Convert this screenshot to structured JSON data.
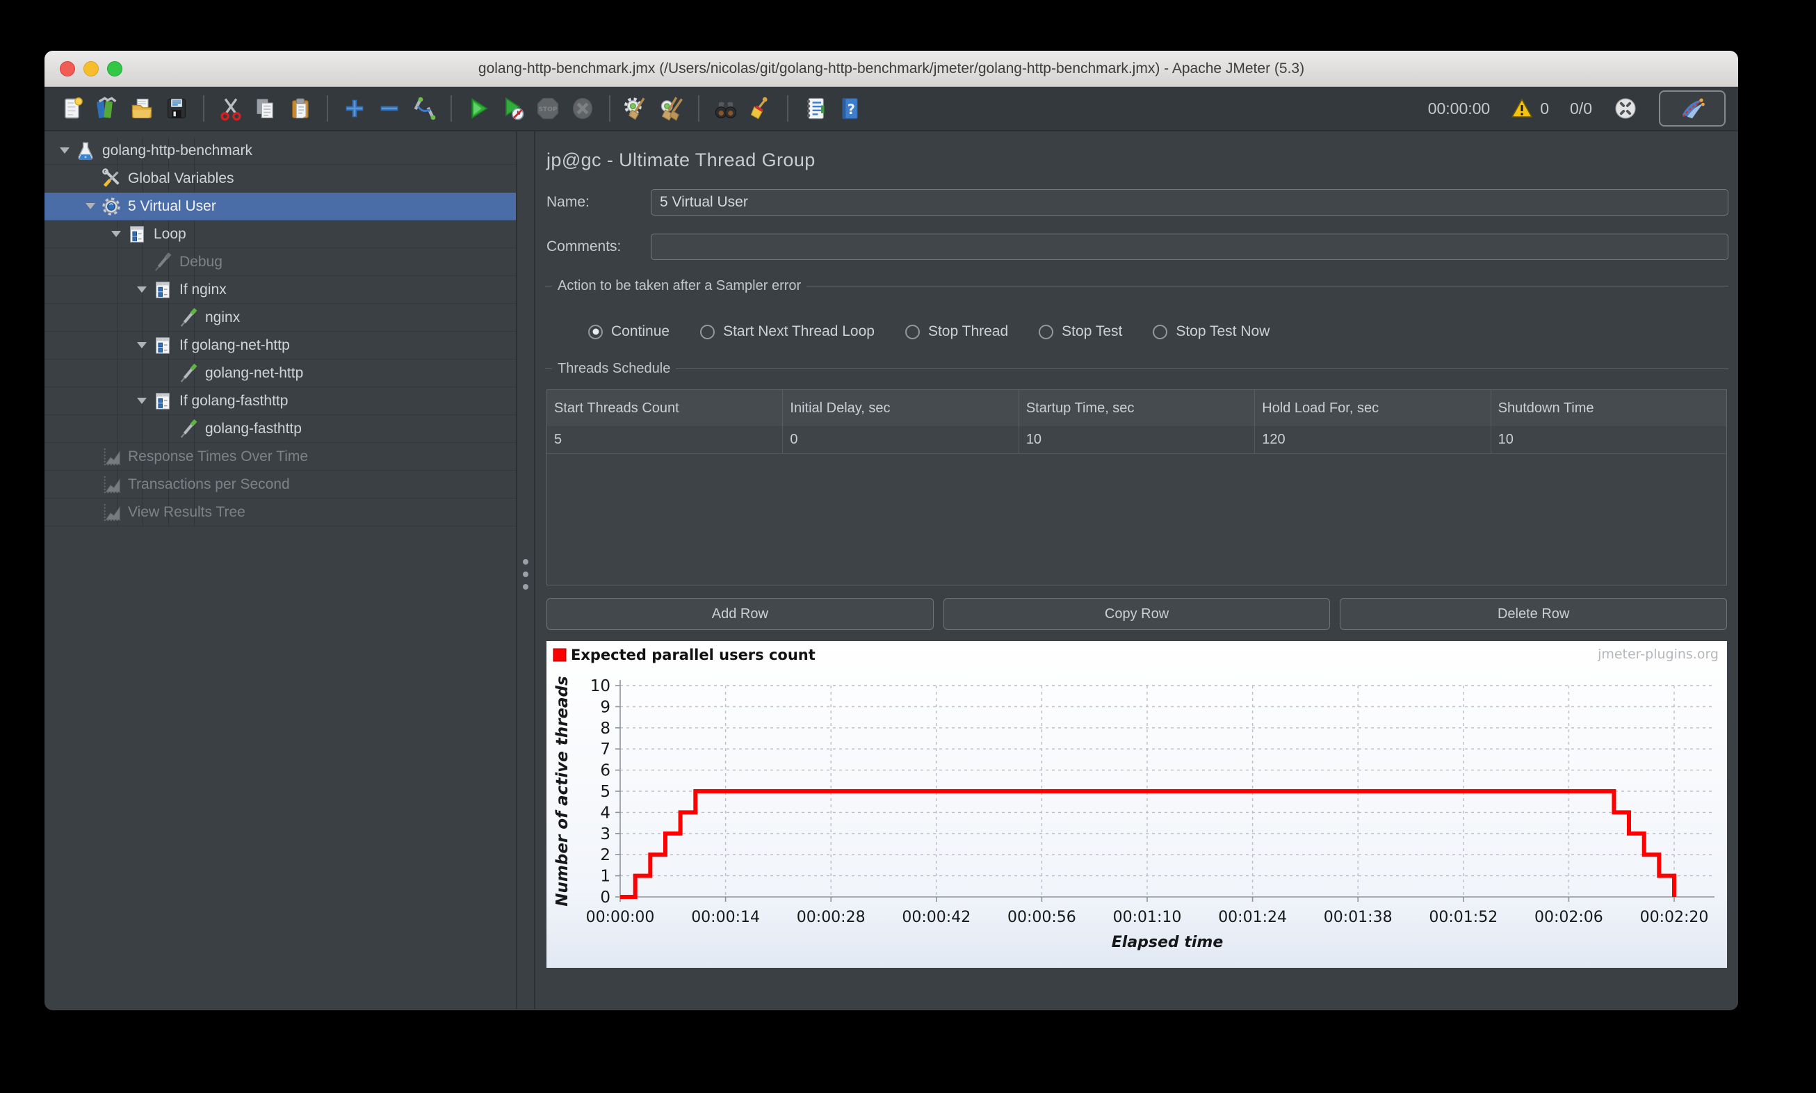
{
  "window": {
    "title": "golang-http-benchmark.jmx (/Users/nicolas/git/golang-http-benchmark/jmeter/golang-http-benchmark.jmx) - Apache JMeter (5.3)"
  },
  "toolbar": {
    "timer": "00:00:00",
    "warning_count": "0",
    "thread_ratio": "0/0",
    "icons": [
      "new-file-icon",
      "templates-icon",
      "open-file-icon",
      "save-icon",
      "cut-icon",
      "copy-icon",
      "paste-icon",
      "add-icon",
      "remove-icon",
      "reset-gui-icon",
      "start-icon",
      "start-no-timers-icon",
      "stop-icon",
      "shutdown-icon",
      "clear-icon",
      "clear-all-icon",
      "search-icon",
      "search-reset-icon",
      "function-helper-icon",
      "help-icon",
      "warning-icon",
      "laf-icon",
      "jmeter-logo-icon"
    ]
  },
  "sidebar": {
    "items": [
      {
        "label": "golang-http-benchmark",
        "icon": "test-plan",
        "level": 0,
        "expanded": true,
        "state": "normal"
      },
      {
        "label": "Global Variables",
        "icon": "arguments",
        "level": 1,
        "state": "normal"
      },
      {
        "label": "5 Virtual User",
        "icon": "thread-group",
        "level": 1,
        "expanded": true,
        "state": "selected"
      },
      {
        "label": "Loop",
        "icon": "controller",
        "level": 2,
        "expanded": true,
        "state": "normal"
      },
      {
        "label": "Debug",
        "icon": "sampler",
        "level": 3,
        "state": "disabled"
      },
      {
        "label": "If nginx",
        "icon": "controller",
        "level": 3,
        "expanded": true,
        "state": "normal"
      },
      {
        "label": "nginx",
        "icon": "sampler",
        "level": 4,
        "state": "normal"
      },
      {
        "label": "If golang-net-http",
        "icon": "controller",
        "level": 3,
        "expanded": true,
        "state": "normal"
      },
      {
        "label": "golang-net-http",
        "icon": "sampler",
        "level": 4,
        "state": "normal"
      },
      {
        "label": "If golang-fasthttp",
        "icon": "controller",
        "level": 3,
        "expanded": true,
        "state": "normal"
      },
      {
        "label": "golang-fasthttp",
        "icon": "sampler",
        "level": 4,
        "state": "normal"
      },
      {
        "label": "Response Times Over Time",
        "icon": "listener",
        "level": 1,
        "state": "disabled"
      },
      {
        "label": "Transactions per Second",
        "icon": "listener",
        "level": 1,
        "state": "disabled"
      },
      {
        "label": "View Results Tree",
        "icon": "listener",
        "level": 1,
        "state": "disabled"
      }
    ]
  },
  "main": {
    "title": "jp@gc - Ultimate Thread Group",
    "name_label": "Name:",
    "name_value": "5 Virtual User",
    "comments_label": "Comments:",
    "comments_value": "",
    "sampler_error": {
      "legend": "Action to be taken after a Sampler error",
      "options": [
        "Continue",
        "Start Next Thread Loop",
        "Stop Thread",
        "Stop Test",
        "Stop Test Now"
      ],
      "selected": "Continue"
    },
    "threads_schedule": {
      "legend": "Threads Schedule",
      "columns": [
        "Start Threads Count",
        "Initial Delay, sec",
        "Startup Time, sec",
        "Hold Load For, sec",
        "Shutdown Time"
      ],
      "rows": [
        [
          "5",
          "0",
          "10",
          "120",
          "10"
        ]
      ]
    },
    "buttons": [
      "Add Row",
      "Copy Row",
      "Delete Row"
    ]
  },
  "chart_data": {
    "type": "line",
    "style": "step",
    "legend": "Expected parallel users count",
    "series_color": "#ff0000",
    "watermark": "jmeter-plugins.org",
    "xlabel": "Elapsed time",
    "ylabel": "Number of active threads",
    "ylim": [
      0,
      10
    ],
    "yticks": [
      0,
      1,
      2,
      3,
      4,
      5,
      6,
      7,
      8,
      9,
      10
    ],
    "xticks": [
      "00:00:00",
      "00:00:14",
      "00:00:28",
      "00:00:42",
      "00:00:56",
      "00:01:10",
      "00:01:24",
      "00:01:38",
      "00:01:52",
      "00:02:06",
      "00:02:20"
    ],
    "xtick_seconds": [
      0,
      14,
      28,
      42,
      56,
      70,
      84,
      98,
      112,
      126,
      140
    ],
    "points_seconds": [
      [
        0,
        0
      ],
      [
        2,
        0
      ],
      [
        2,
        1
      ],
      [
        4,
        1
      ],
      [
        4,
        2
      ],
      [
        6,
        2
      ],
      [
        6,
        3
      ],
      [
        8,
        3
      ],
      [
        8,
        4
      ],
      [
        10,
        4
      ],
      [
        10,
        5
      ],
      [
        132,
        5
      ],
      [
        132,
        4
      ],
      [
        134,
        4
      ],
      [
        134,
        3
      ],
      [
        136,
        3
      ],
      [
        136,
        2
      ],
      [
        138,
        2
      ],
      [
        138,
        1
      ],
      [
        140,
        1
      ],
      [
        140,
        0
      ]
    ]
  }
}
